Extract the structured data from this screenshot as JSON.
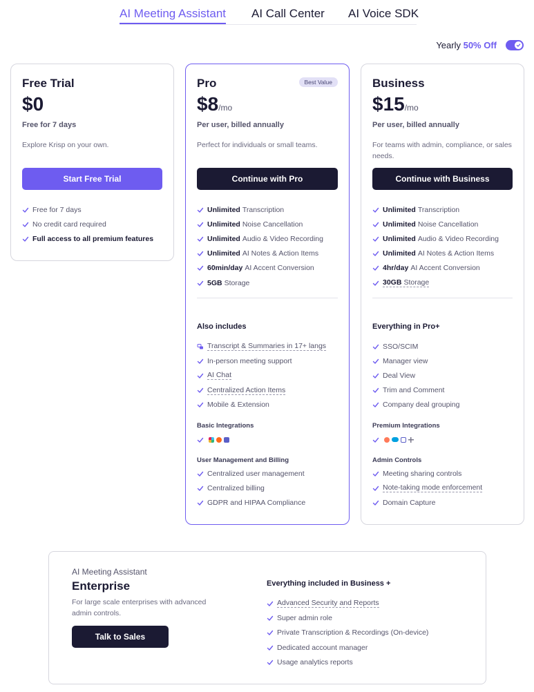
{
  "tabs": [
    {
      "label": "AI Meeting Assistant",
      "active": true
    },
    {
      "label": "AI Call Center",
      "active": false
    },
    {
      "label": "AI Voice SDK",
      "active": false
    }
  ],
  "billing": {
    "label": "Yearly",
    "discount": "50% Off",
    "toggle_on": true
  },
  "colors": {
    "accent": "#6e5cf0",
    "dark": "#1b1a33",
    "badge_bg": "#e2e0f6"
  },
  "plans": {
    "free": {
      "title": "Free Trial",
      "price": "$0",
      "billed": "Free for 7 days",
      "desc": "Explore Krisp on your own.",
      "cta": "Start Free Trial",
      "features": [
        "Free for 7 days",
        "No credit card required",
        "Full access to all premium features"
      ]
    },
    "pro": {
      "title": "Pro",
      "badge": "Best Value",
      "price": "$8",
      "per": "/mo",
      "billed": "Per user, billed annually",
      "desc": "Perfect for individuals or small teams.",
      "cta": "Continue with Pro",
      "features": [
        {
          "b": "Unlimited",
          "t": "Transcription"
        },
        {
          "b": "Unlimited",
          "t": "Noise Cancellation"
        },
        {
          "b": "Unlimited",
          "t": "Audio & Video Recording"
        },
        {
          "b": "Unlimited",
          "t": "AI Notes & Action Items"
        },
        {
          "b": "60min/day",
          "t": "AI Accent Conversion"
        },
        {
          "b": "5GB",
          "t": "Storage"
        }
      ],
      "also_head": "Also includes",
      "also": [
        "Transcript & Summaries in 17+ langs",
        "In-person meeting support",
        "AI Chat",
        "Centralized Action Items",
        "Mobile & Extension"
      ],
      "integrations_head": "Basic Integrations",
      "integration_icons": [
        "slack-icon",
        "zapier-icon",
        "teams-icon"
      ],
      "admin_head": "User Management and Billing",
      "admin": [
        "Centralized user management",
        "Centralized billing",
        "GDPR and HIPAA Compliance"
      ]
    },
    "business": {
      "title": "Business",
      "price": "$15",
      "per": "/mo",
      "billed": "Per user, billed annually",
      "desc": "For teams with admin, compliance, or sales needs.",
      "cta": "Continue with Business",
      "features": [
        {
          "b": "Unlimited",
          "t": "Transcription"
        },
        {
          "b": "Unlimited",
          "t": "Noise Cancellation"
        },
        {
          "b": "Unlimited",
          "t": "Audio & Video Recording"
        },
        {
          "b": "Unlimited",
          "t": "AI Notes & Action Items"
        },
        {
          "b": "4hr/day",
          "t": "AI Accent Conversion"
        },
        {
          "b": "30GB",
          "t": "Storage"
        }
      ],
      "also_head": "Everything in Pro+",
      "also": [
        "SSO/SCIM",
        "Manager view",
        "Deal View",
        "Trim and Comment",
        "Company deal grouping"
      ],
      "integrations_head": "Premium Integrations",
      "integration_icons": [
        "hubspot-icon",
        "salesforce-icon",
        "apps-icon",
        "plus-icon"
      ],
      "admin_head": "Admin Controls",
      "admin": [
        "Meeting sharing controls",
        "Note-taking mode enforcement",
        "Domain Capture"
      ]
    }
  },
  "enterprise": {
    "eyebrow": "AI Meeting Assistant",
    "title": "Enterprise",
    "desc": "For large scale enterprises with advanced admin controls.",
    "cta": "Talk to Sales",
    "head": "Everything included in Business +",
    "features": [
      "Advanced Security and Reports",
      "Super admin role",
      "Private Transcription & Recordings (On-device)",
      "Dedicated account manager",
      "Usage analytics reports"
    ]
  }
}
